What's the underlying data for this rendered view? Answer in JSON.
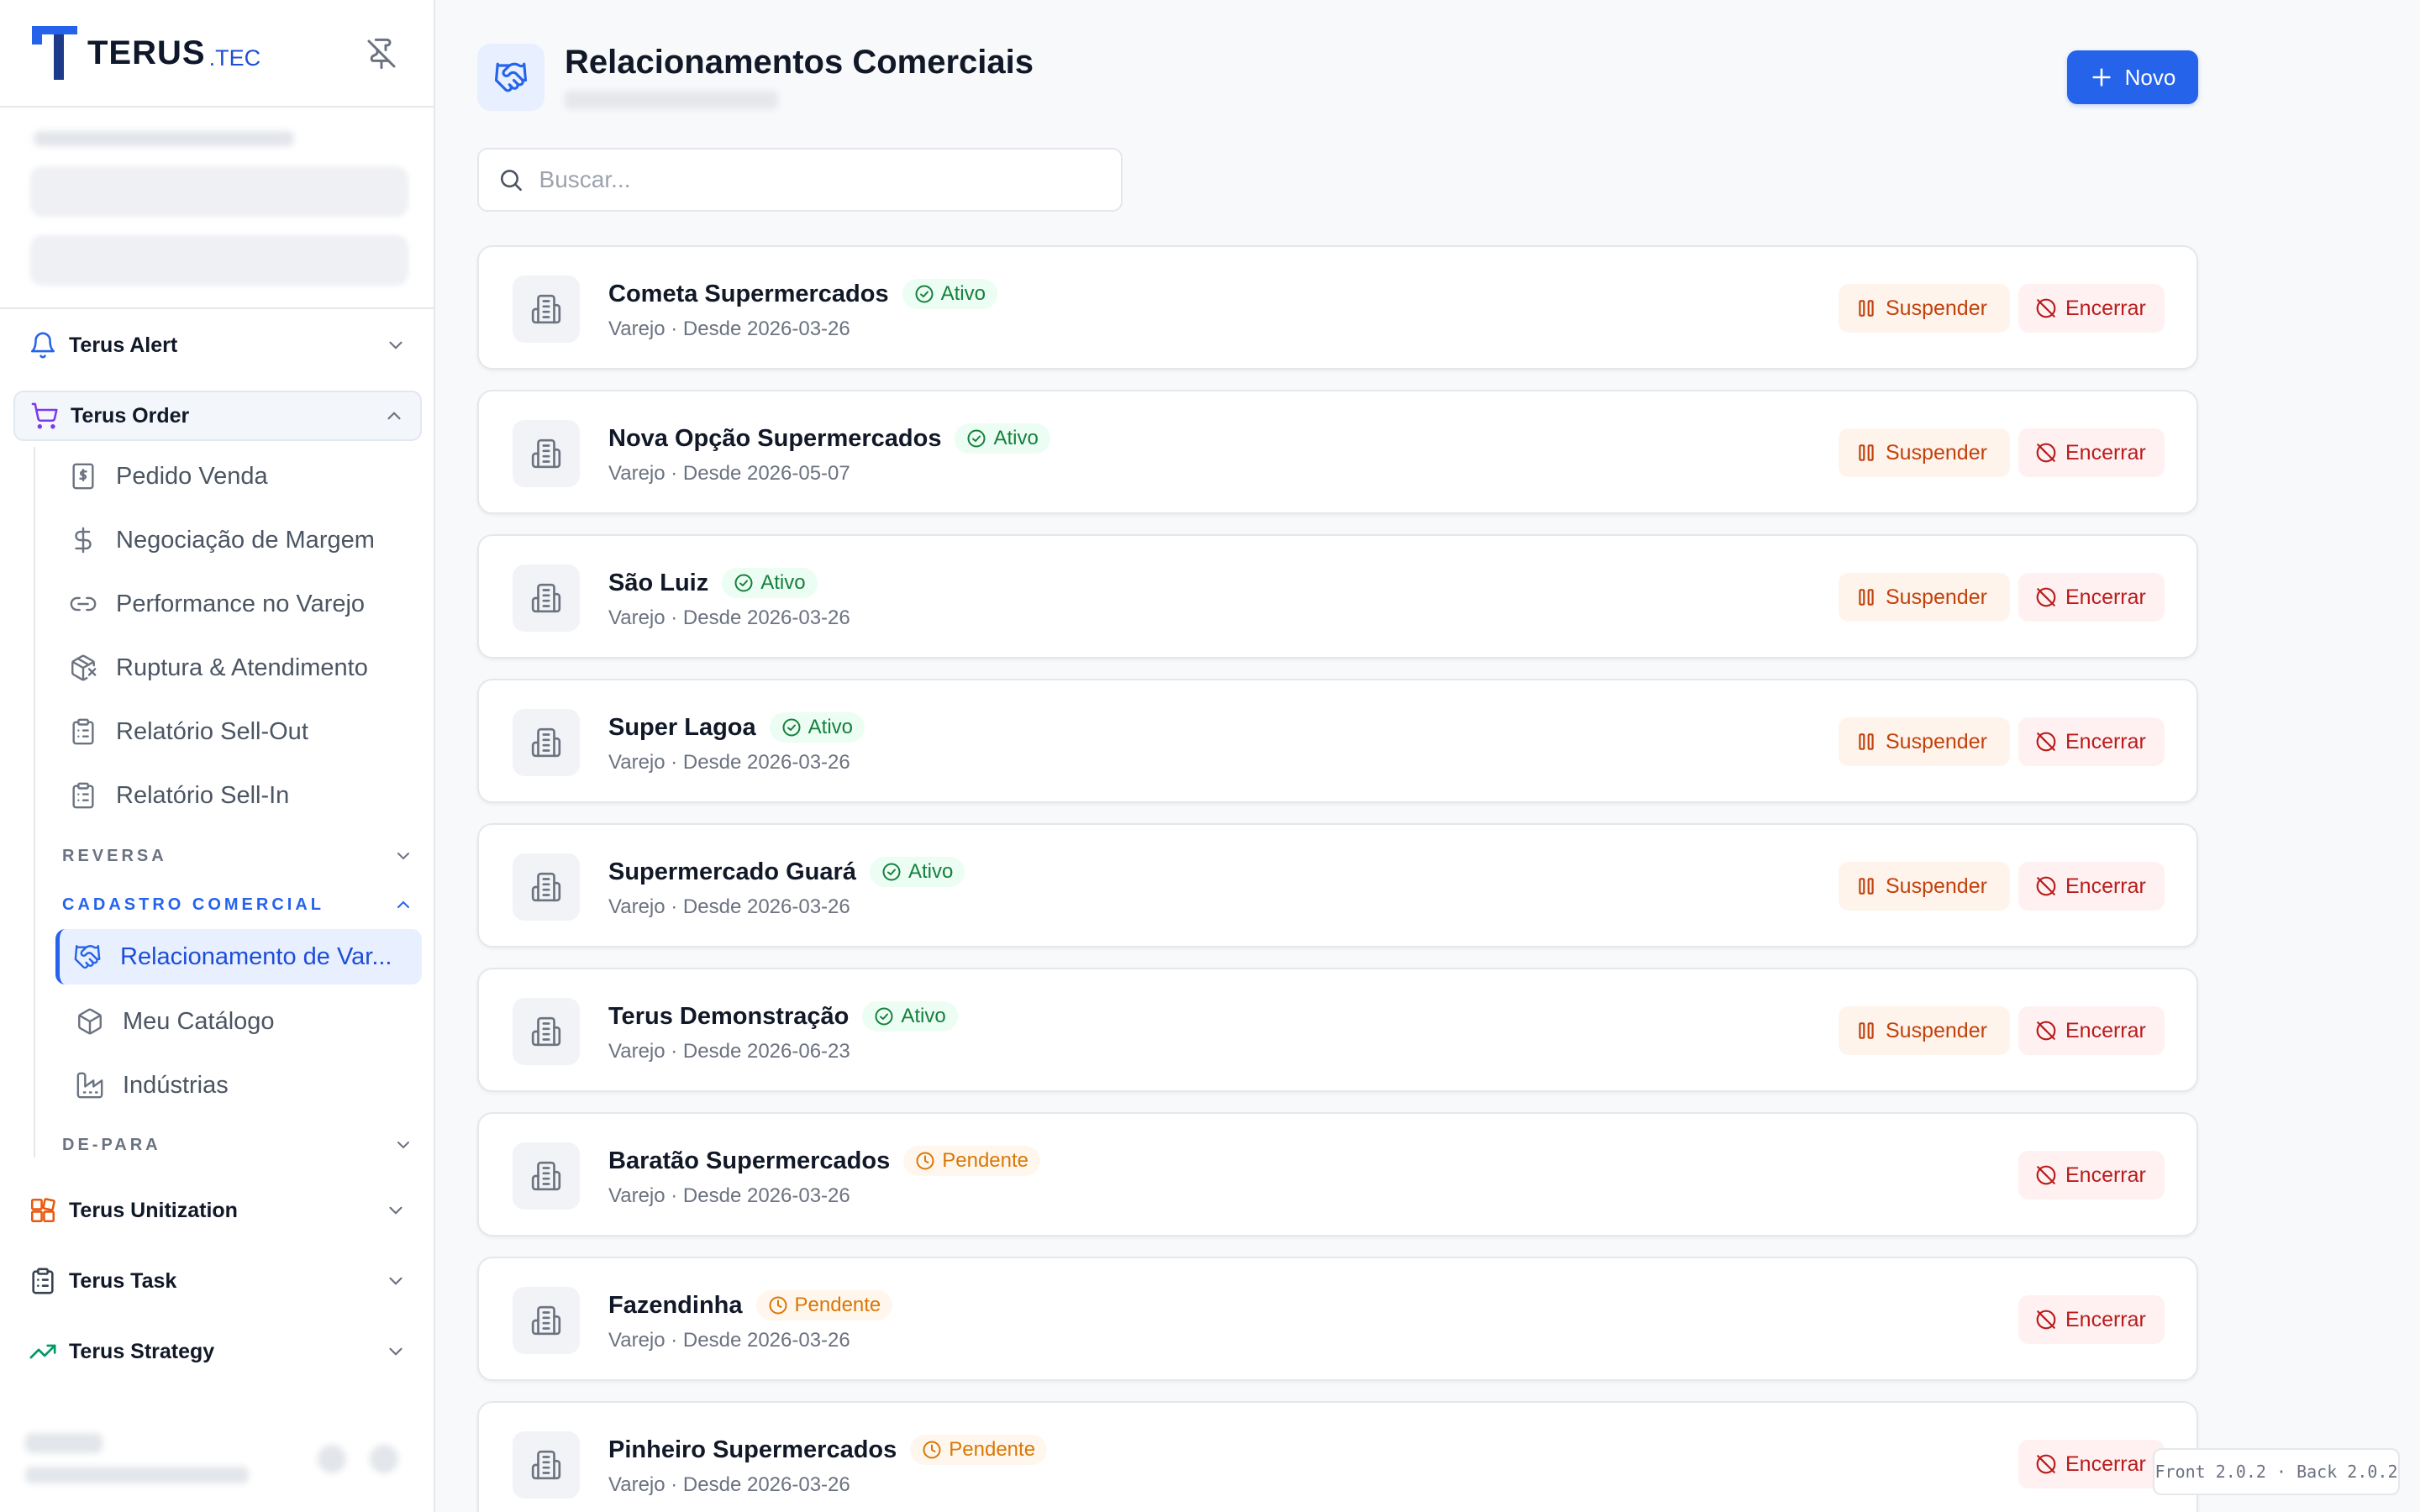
{
  "brand": {
    "name": "TERUS",
    "suffix": ".TEC"
  },
  "colors": {
    "primary": "#2563eb",
    "success": "#15803d",
    "warning": "#d97706",
    "danger": "#b91c1c",
    "suspend": "#c2410c"
  },
  "sidebar": {
    "pin_icon": "pin-off-icon",
    "modules": [
      {
        "label": "Terus Alert",
        "icon": "bell-icon",
        "expanded": false
      },
      {
        "label": "Terus Order",
        "icon": "shopping-cart-icon",
        "expanded": true
      },
      {
        "label": "Terus Unitization",
        "icon": "boxes-icon",
        "expanded": false
      },
      {
        "label": "Terus Task",
        "icon": "clipboard-icon",
        "expanded": false
      },
      {
        "label": "Terus Strategy",
        "icon": "trending-up-icon",
        "expanded": false
      }
    ],
    "order_items": [
      {
        "label": "Pedido Venda",
        "icon": "receipt-icon"
      },
      {
        "label": "Negociação de Margem",
        "icon": "dollar-icon"
      },
      {
        "label": "Performance no Varejo",
        "icon": "link-icon"
      },
      {
        "label": "Ruptura & Atendimento",
        "icon": "package-x-icon"
      },
      {
        "label": "Relatório Sell-Out",
        "icon": "clipboard-list-icon"
      },
      {
        "label": "Relatório Sell-In",
        "icon": "clipboard-list-icon"
      }
    ],
    "sections": [
      {
        "label": "REVERSA",
        "expanded": false
      },
      {
        "label": "CADASTRO COMERCIAL",
        "expanded": true
      },
      {
        "label": "DE-PARA",
        "expanded": false
      }
    ],
    "cadastro_items": [
      {
        "label": "Relacionamento de Var...",
        "icon": "handshake-icon",
        "active": true
      },
      {
        "label": "Meu Catálogo",
        "icon": "package-icon",
        "active": false
      },
      {
        "label": "Indústrias",
        "icon": "factory-icon",
        "active": false
      }
    ]
  },
  "header": {
    "title": "Relacionamentos Comerciais",
    "new_button": "Novo"
  },
  "search": {
    "placeholder": "Buscar...",
    "value": ""
  },
  "relationships": [
    {
      "name": "Cometa Supermercados",
      "status": "Ativo",
      "meta": "Varejo · Desde 2026-03-26",
      "can_suspend": true
    },
    {
      "name": "Nova Opção Supermercados",
      "status": "Ativo",
      "meta": "Varejo · Desde 2026-05-07",
      "can_suspend": true
    },
    {
      "name": "São Luiz",
      "status": "Ativo",
      "meta": "Varejo · Desde 2026-03-26",
      "can_suspend": true
    },
    {
      "name": "Super Lagoa",
      "status": "Ativo",
      "meta": "Varejo · Desde 2026-03-26",
      "can_suspend": true
    },
    {
      "name": "Supermercado Guará",
      "status": "Ativo",
      "meta": "Varejo · Desde 2026-03-26",
      "can_suspend": true
    },
    {
      "name": "Terus Demonstração",
      "status": "Ativo",
      "meta": "Varejo · Desde 2026-06-23",
      "can_suspend": true
    },
    {
      "name": "Baratão Supermercados",
      "status": "Pendente",
      "meta": "Varejo · Desde 2026-03-26",
      "can_suspend": false
    },
    {
      "name": "Fazendinha",
      "status": "Pendente",
      "meta": "Varejo · Desde 2026-03-26",
      "can_suspend": false
    },
    {
      "name": "Pinheiro Supermercados",
      "status": "Pendente",
      "meta": "Varejo · Desde 2026-03-26",
      "can_suspend": false
    }
  ],
  "actions": {
    "suspend": "Suspender",
    "end": "Encerrar"
  },
  "version": "Front 2.0.2 · Back 2.0.2"
}
